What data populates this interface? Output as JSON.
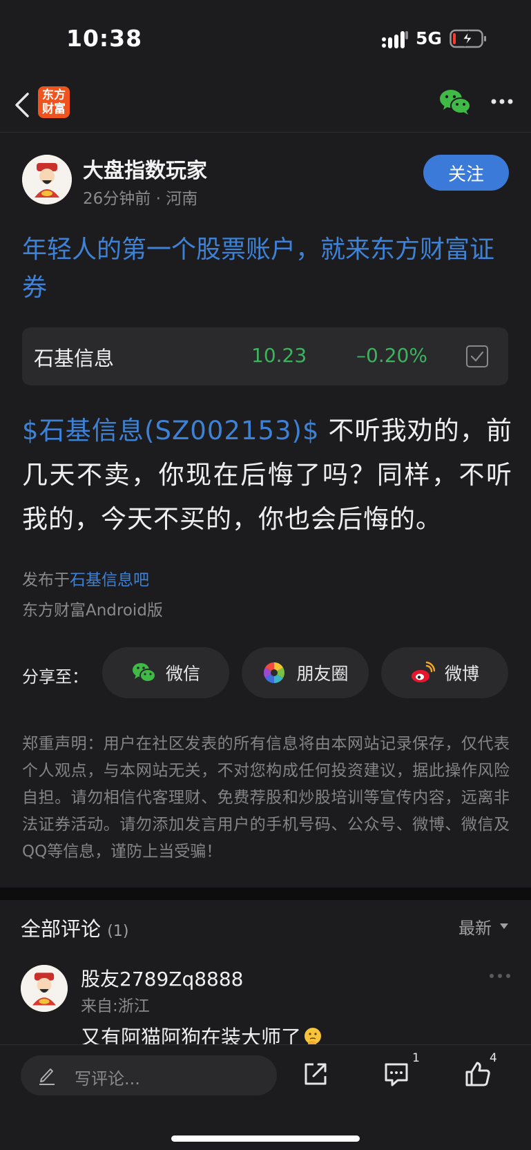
{
  "status_bar": {
    "time": "10:38",
    "network": "5G"
  },
  "nav": {
    "logo_text": "东方\n财富"
  },
  "author": {
    "name": "大盘指数玩家",
    "meta": "26分钟前 · 河南",
    "follow_label": "关注"
  },
  "ad_title": "年轻人的第一个股票账户，就来东方财富证券",
  "stock": {
    "name": "石基信息",
    "price": "10.23",
    "change": "–0.20%"
  },
  "post": {
    "stock_tag": "$石基信息(SZ002153)$",
    "text": " 不听我劝的，前几天不卖，你现在后悔了吗？同样，不听我的，今天不买的，你也会后悔的。",
    "published_prefix": "发布于",
    "published_bar": "石基信息吧",
    "client": "东方财富Android版"
  },
  "share": {
    "label": "分享至：",
    "wechat": "微信",
    "moments": "朋友圈",
    "weibo": "微博"
  },
  "disclaimer": "郑重声明：用户在社区发表的所有信息将由本网站记录保存，仅代表个人观点，与本网站无关，不对您构成任何投资建议，据此操作风险自担。请勿相信代客理财、免费荐股和炒股培训等宣传内容，远离非法证券活动。请勿添加发言用户的手机号码、公众号、微博、微信及QQ等信息，谨防上当受骗！",
  "comments": {
    "title": "全部评论",
    "count": "(1)",
    "sort": "最新",
    "items": [
      {
        "user": "股友2789Zq8888",
        "location": "来自:浙江",
        "text": "又有阿猫阿狗在装大师了"
      }
    ]
  },
  "bottom_bar": {
    "placeholder": "写评论...",
    "comment_count": "1",
    "like_count": "4"
  },
  "colors": {
    "accent": "#3d82d6",
    "down": "#3db35f",
    "follow": "#3b7ad8",
    "background": "#1c1c1e"
  }
}
